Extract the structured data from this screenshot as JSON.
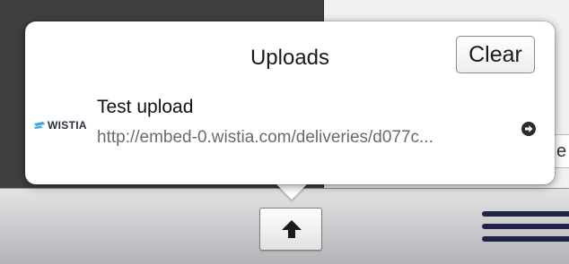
{
  "popover": {
    "title": "Uploads",
    "clear_label": "Clear",
    "items": [
      {
        "logo_text": "WISTIA",
        "name": "Test upload",
        "url": "http://embed-0.wistia.com/deliveries/d077c..."
      }
    ]
  },
  "background": {
    "field_fragment": "e"
  },
  "icons": {
    "upload_toggle": "up-arrow-icon",
    "open_item": "circle-arrow-right-icon",
    "menu": "hamburger-lines-icon"
  },
  "colors": {
    "logo_accent": "#3aa9e0",
    "menu_lines": "#1f2447"
  }
}
